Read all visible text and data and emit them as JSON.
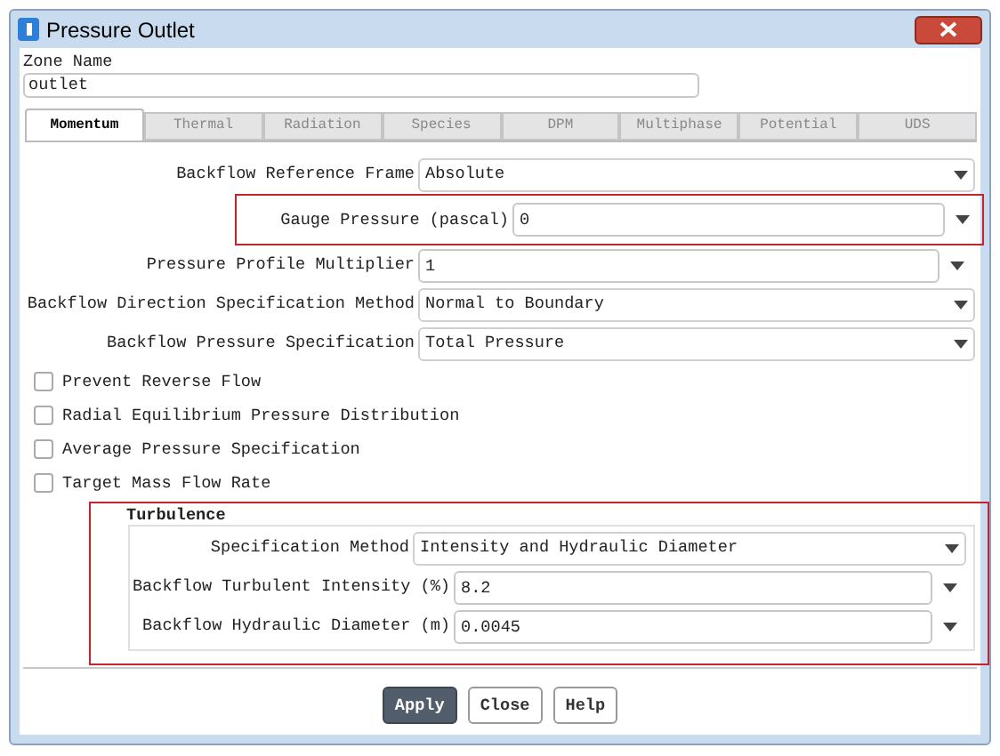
{
  "window": {
    "title": "Pressure Outlet"
  },
  "zone_name": {
    "label": "Zone Name",
    "value": "outlet"
  },
  "tabs": [
    {
      "label": "Momentum",
      "selected": true
    },
    {
      "label": "Thermal",
      "selected": false
    },
    {
      "label": "Radiation",
      "selected": false
    },
    {
      "label": "Species",
      "selected": false
    },
    {
      "label": "DPM",
      "selected": false
    },
    {
      "label": "Multiphase",
      "selected": false
    },
    {
      "label": "Potential",
      "selected": false
    },
    {
      "label": "UDS",
      "selected": false
    }
  ],
  "fields": [
    {
      "kind": "dropdown",
      "label": "Backflow Reference Frame",
      "value": "Absolute",
      "highlighted": false
    },
    {
      "kind": "input",
      "label": "Gauge Pressure (pascal)",
      "value": "0",
      "highlighted": true
    },
    {
      "kind": "input",
      "label": "Pressure Profile Multiplier",
      "value": "1",
      "highlighted": false
    },
    {
      "kind": "dropdown",
      "label": "Backflow Direction Specification Method",
      "value": "Normal to Boundary",
      "highlighted": false
    },
    {
      "kind": "dropdown",
      "label": "Backflow Pressure Specification",
      "value": "Total Pressure",
      "highlighted": false
    }
  ],
  "checkboxes": [
    {
      "label": "Prevent Reverse Flow",
      "checked": false
    },
    {
      "label": "Radial Equilibrium Pressure Distribution",
      "checked": false
    },
    {
      "label": "Average Pressure Specification",
      "checked": false
    },
    {
      "label": "Target Mass Flow Rate",
      "checked": false
    }
  ],
  "turbulence": {
    "title": "Turbulence",
    "highlighted": true,
    "fields": [
      {
        "kind": "dropdown",
        "label": "Specification Method",
        "value": "Intensity and Hydraulic Diameter"
      },
      {
        "kind": "input",
        "label": "Backflow Turbulent Intensity (%)",
        "value": "8.2"
      },
      {
        "kind": "input",
        "label": "Backflow Hydraulic Diameter (m)",
        "value": "0.0045"
      }
    ]
  },
  "buttons": [
    {
      "label": "Apply",
      "kind": "primary"
    },
    {
      "label": "Close",
      "kind": "default"
    },
    {
      "label": "Help",
      "kind": "default"
    }
  ]
}
